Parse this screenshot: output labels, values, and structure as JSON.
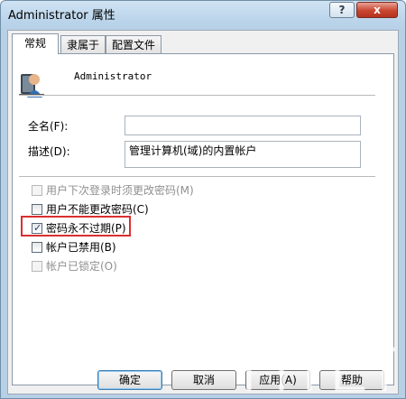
{
  "window": {
    "title": "Administrator 属性"
  },
  "titlebar_buttons": {
    "help": "?",
    "close": "x"
  },
  "tabs": [
    {
      "label": "常规",
      "active": true
    },
    {
      "label": "隶属于",
      "active": false
    },
    {
      "label": "配置文件",
      "active": false
    }
  ],
  "user": {
    "name": "Administrator",
    "icon": "user-icon"
  },
  "fields": {
    "fullname": {
      "label": "全名(F):",
      "value": ""
    },
    "description": {
      "label": "描述(D):",
      "value": "管理计算机(域)的内置帐户"
    }
  },
  "checkboxes": [
    {
      "label": "用户下次登录时须更改密码(M)",
      "checked": false,
      "enabled": false
    },
    {
      "label": "用户不能更改密码(C)",
      "checked": false,
      "enabled": true
    },
    {
      "label": "密码永不过期(P)",
      "checked": true,
      "enabled": true
    },
    {
      "label": "帐户已禁用(B)",
      "checked": false,
      "enabled": true
    },
    {
      "label": "帐户已锁定(O)",
      "checked": false,
      "enabled": false
    }
  ],
  "buttons": {
    "ok": "确定",
    "cancel": "取消",
    "apply": "应用(A)",
    "help": "帮助"
  },
  "colors": {
    "highlight": "#d9302e",
    "titlebar": "#b9d3ea"
  }
}
